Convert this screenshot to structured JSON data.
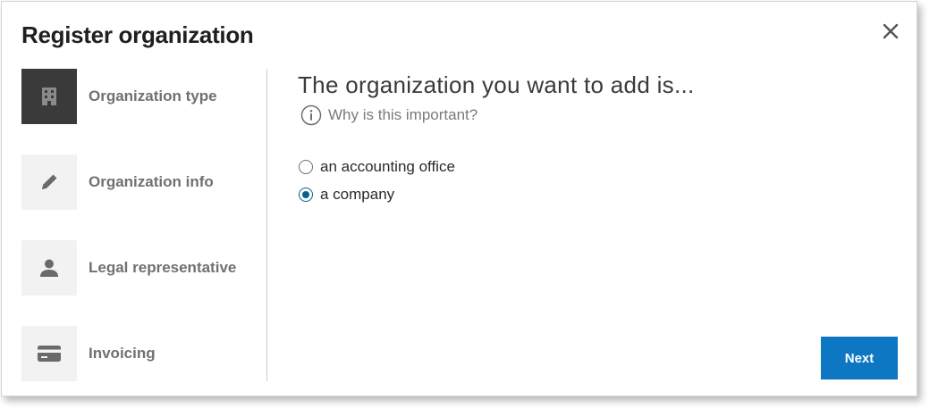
{
  "dialog": {
    "title": "Register organization",
    "close_icon": "close-icon"
  },
  "steps": [
    {
      "label": "Organization type",
      "icon": "building-icon",
      "active": true
    },
    {
      "label": "Organization info",
      "icon": "pencil-icon",
      "active": false
    },
    {
      "label": "Legal representative",
      "icon": "person-icon",
      "active": false
    },
    {
      "label": "Invoicing",
      "icon": "credit-card-icon",
      "active": false
    }
  ],
  "main": {
    "question": "The organization you want to add is...",
    "help_link": "Why is this important?",
    "help_icon": "info-icon",
    "options": [
      {
        "label": "an accounting office",
        "selected": false
      },
      {
        "label": "a company",
        "selected": true
      }
    ]
  },
  "footer": {
    "next_label": "Next"
  },
  "colors": {
    "accent": "#0d77c4",
    "radio_selected": "#0a5f8c",
    "active_step_bg": "#3a3a3a"
  }
}
